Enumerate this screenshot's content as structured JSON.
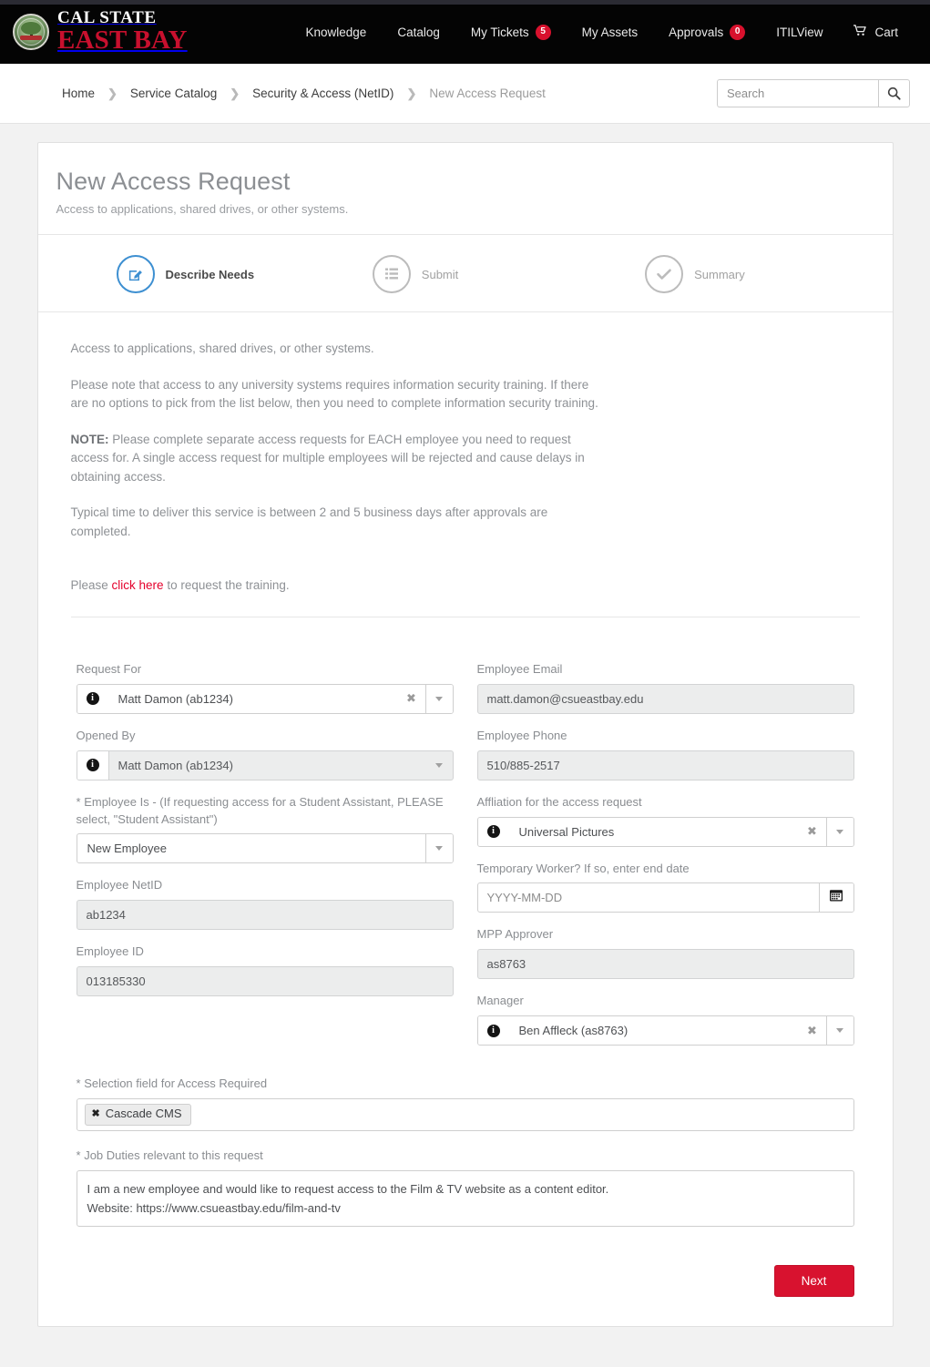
{
  "header": {
    "logo": {
      "seal_alt": "cal-state-east-bay-seal",
      "line1": "CAL STATE",
      "line2": "EAST BAY"
    },
    "nav": [
      {
        "label": "Knowledge",
        "badge": null,
        "icon": null
      },
      {
        "label": "Catalog",
        "badge": null,
        "icon": null
      },
      {
        "label": "My Tickets",
        "badge": "5",
        "icon": null
      },
      {
        "label": "My Assets",
        "badge": null,
        "icon": null
      },
      {
        "label": "Approvals",
        "badge": "0",
        "icon": null
      },
      {
        "label": "ITILView",
        "badge": null,
        "icon": null
      },
      {
        "label": "Cart",
        "badge": null,
        "icon": "cart-icon"
      }
    ],
    "badge_color": "#d8112d",
    "brand_red": "#c8102e"
  },
  "breadcrumb": {
    "items": [
      {
        "label": "Home",
        "current": false
      },
      {
        "label": "Service Catalog",
        "current": false
      },
      {
        "label": "Security & Access (NetID)",
        "current": false
      },
      {
        "label": "New Access Request",
        "current": true
      }
    ],
    "separator": "❯"
  },
  "search": {
    "placeholder": "Search",
    "value": "",
    "button_icon": "search-icon"
  },
  "page": {
    "title": "New Access Request",
    "subtitle": "Access to applications, shared drives, or other systems."
  },
  "steps": [
    {
      "label": "Describe Needs",
      "icon": "pencil-square-icon",
      "active": true
    },
    {
      "label": "Submit",
      "icon": "list-icon",
      "active": false
    },
    {
      "label": "Summary",
      "icon": "check-circle-icon",
      "active": false
    }
  ],
  "description": {
    "p1": "Access to applications, shared drives, or other systems.",
    "p2": "Please note that access to any university systems requires information security training. If there are no options to pick from the list below, then you need to complete information security training.",
    "p3_strong": "NOTE:",
    "p3": " Please complete separate access requests for EACH employee you need to request access for. A single access request for multiple employees will be rejected and cause delays in obtaining access.",
    "p4": "Typical time to deliver this service is between 2 and 5 business days after approvals are completed.",
    "training_prefix": "Please ",
    "training_link": "click here",
    "training_suffix": " to request the training.",
    "link_color": "#e4002b"
  },
  "form": {
    "request_for": {
      "label": "Request For",
      "value": "Matt Damon (ab1234)",
      "icon": "info-circle-icon",
      "clear": "✖",
      "readonly": false
    },
    "opened_by": {
      "label": "Opened By",
      "value": "Matt Damon (ab1234)",
      "icon": "info-circle-icon",
      "readonly": true
    },
    "employee_is": {
      "label": "Employee Is - (If requesting access for a Student Assistant, PLEASE select, \"Student Assistant\")",
      "required": "*",
      "value": "New Employee",
      "options": [
        "New Employee"
      ]
    },
    "employee_netid": {
      "label": "Employee NetID",
      "value": "ab1234",
      "readonly": true
    },
    "employee_id": {
      "label": "Employee ID",
      "value": "013185330",
      "readonly": true
    },
    "employee_email": {
      "label": "Employee Email",
      "value": "matt.damon@csueastbay.edu",
      "readonly": true
    },
    "employee_phone": {
      "label": "Employee Phone",
      "value": "510/885-2517",
      "readonly": true
    },
    "affiliation": {
      "label": "Affliation for the access request",
      "value": "Universal Pictures",
      "icon": "info-circle-icon",
      "clear": "✖"
    },
    "temp_worker": {
      "label": "Temporary Worker? If so, enter end date",
      "value": "",
      "placeholder": "YYYY-MM-DD",
      "icon": "calendar-icon"
    },
    "mpp_approver": {
      "label": "MPP Approver",
      "value": "as8763",
      "readonly": true
    },
    "manager": {
      "label": "Manager",
      "value": "Ben Affleck (as8763)",
      "icon": "info-circle-icon",
      "clear": "✖"
    },
    "access_required": {
      "label": "Selection field for Access Required",
      "required": "*",
      "chips": [
        {
          "label": "Cascade CMS",
          "remove": "✖"
        }
      ]
    },
    "job_duties": {
      "label": "Job Duties relevant to this request",
      "required": "*",
      "value": "I am a new employee and would like to request access to the Film & TV website as a content editor.\nWebsite: https://www.csueastbay.edu/film-and-tv"
    }
  },
  "actions": {
    "next_label": "Next",
    "next_color": "#d8122f"
  }
}
